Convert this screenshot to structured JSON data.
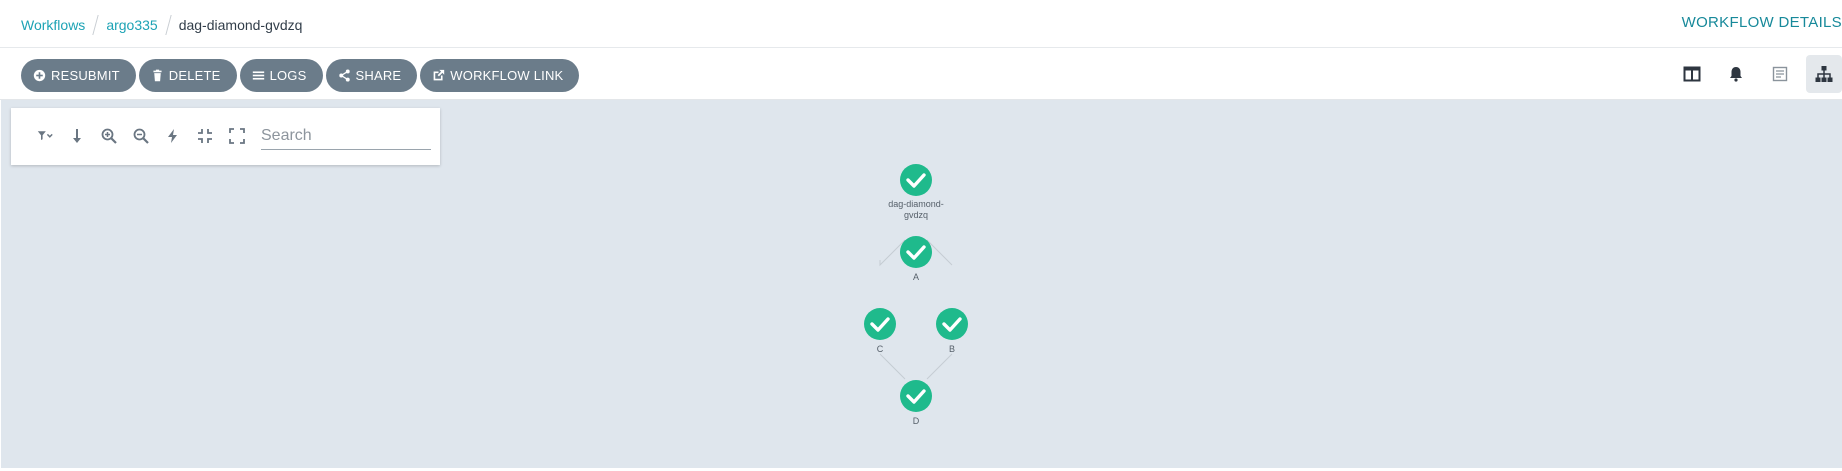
{
  "breadcrumb": {
    "workflows": "Workflows",
    "namespace": "argo335",
    "workflow": "dag-diamond-gvdzq"
  },
  "page_title": "WORKFLOW DETAILS",
  "actions": {
    "resubmit": "RESUBMIT",
    "delete": "DELETE",
    "logs": "LOGS",
    "share": "SHARE",
    "workflow_link": "WORKFLOW LINK"
  },
  "view_icons": [
    "split-view-icon",
    "bell-icon",
    "summary-icon",
    "tree-graph-icon"
  ],
  "graph_tools": [
    "filter-icon",
    "arrow-down-icon",
    "zoom-in-icon",
    "zoom-out-icon",
    "bolt-icon",
    "collapse-icon",
    "fullscreen-icon"
  ],
  "search": {
    "placeholder": "Search",
    "value": ""
  },
  "nodes": {
    "root": {
      "line1": "dag-diamond-",
      "line2": "gvdzq",
      "status": "succeeded"
    },
    "a": {
      "label": "A",
      "status": "succeeded"
    },
    "b": {
      "label": "B",
      "status": "succeeded"
    },
    "c": {
      "label": "C",
      "status": "succeeded"
    },
    "d": {
      "label": "D",
      "status": "succeeded"
    }
  },
  "colors": {
    "success": "#1fba8c",
    "accent": "#1a9aae",
    "button": "#6b7c8a",
    "canvas": "#dfe6ed"
  }
}
